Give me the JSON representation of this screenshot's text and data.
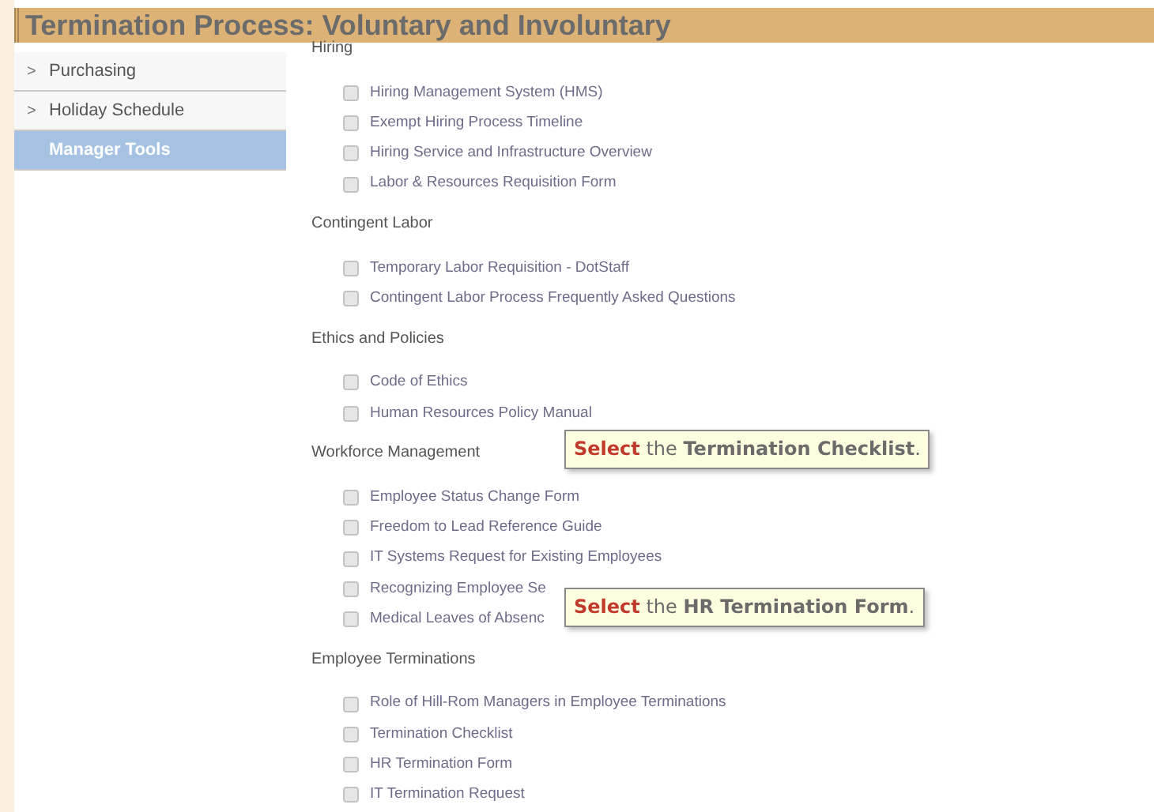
{
  "title": "Termination Process: Voluntary and Involuntary",
  "sidebar": {
    "items": [
      {
        "label": "Purchasing",
        "marker": ">",
        "selected": false
      },
      {
        "label": "Holiday Schedule",
        "marker": ">",
        "selected": false
      },
      {
        "label": "Manager Tools",
        "selected": true
      }
    ]
  },
  "sections": [
    {
      "heading": "Hiring",
      "items": [
        {
          "label": "Hiring Management System (HMS)",
          "checked": false
        },
        {
          "label": "Exempt Hiring Process Timeline",
          "checked": false
        },
        {
          "label": "Hiring Service and Infrastructure Overview",
          "checked": false
        },
        {
          "label": "Labor & Resources Requisition Form",
          "checked": false
        }
      ]
    },
    {
      "heading": "Contingent Labor",
      "items": [
        {
          "label": "Temporary Labor Requisition - DotStaff",
          "checked": false
        },
        {
          "label": "Contingent Labor Process Frequently Asked Questions",
          "checked": false
        }
      ]
    },
    {
      "heading": "Ethics and Policies",
      "items": [
        {
          "label": "Code of Ethics",
          "checked": false
        },
        {
          "label": "Human Resources Policy Manual",
          "checked": false
        }
      ]
    },
    {
      "heading": "Workforce Management",
      "items": [
        {
          "label": "Employee Status Change Form",
          "checked": false
        },
        {
          "label": "Freedom to Lead Reference Guide",
          "checked": false
        },
        {
          "label": "IT Systems Request for Existing Employees",
          "checked": false
        },
        {
          "label": "Recognizing Employee Se",
          "checked": false
        },
        {
          "label": "Medical Leaves of Absenc",
          "checked": false
        }
      ]
    },
    {
      "heading": "Employee Terminations",
      "items": [
        {
          "label": "Role of Hill-Rom Managers in Employee Terminations",
          "checked": false
        },
        {
          "label": "Termination Checklist",
          "checked": false
        },
        {
          "label": "HR Termination Form",
          "checked": false
        },
        {
          "label": "IT Termination Request",
          "checked": false
        }
      ]
    }
  ],
  "callouts": [
    "**Select** the **Termination Checklist**.",
    "**Select** the **HR Termination Form**."
  ]
}
